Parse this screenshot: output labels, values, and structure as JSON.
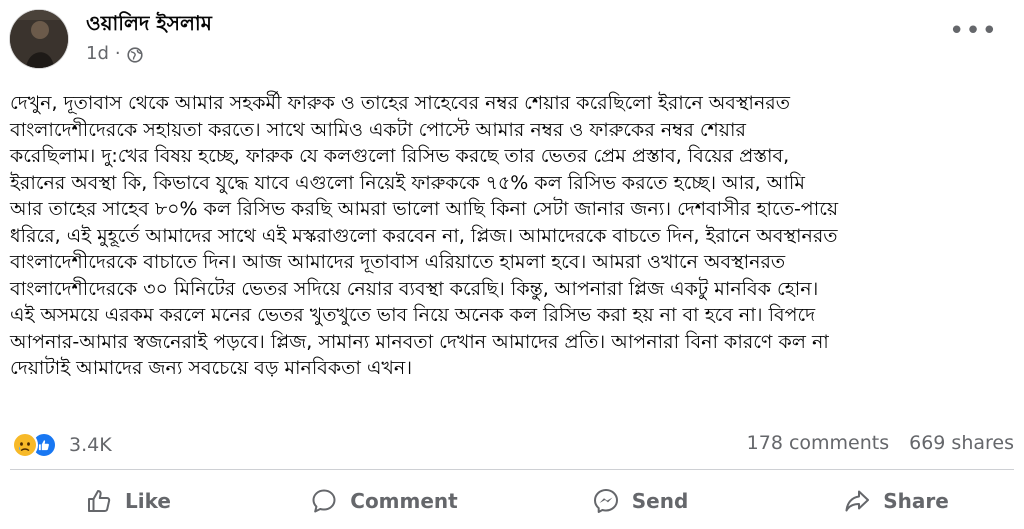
{
  "post": {
    "author": "ওয়ালিদ ইসলাম",
    "time": "1d",
    "separator": "·",
    "privacy_icon": "globe-icon",
    "more_label": "•••",
    "text": "দেখুন, দূতাবাস থেকে আমার সহকর্মী ফারুক ও তাহের সাহেবের নম্বর শেয়ার করেছিলো ইরানে অবস্থানরত\nবাংলাদেশীদেরকে সহায়তা করতে। সাথে আমিও একটা পোস্টে আমার নম্বর ও ফারুকের নম্বর শেয়ার\nকরেছিলাম। দু:খের বিষয় হচ্ছে, ফারুক যে কলগুলো রিসিভ করছে তার ভেতর প্রেম প্রস্তাব, বিয়ের প্রস্তাব,\nইরানের অবস্থা কি, কিভাবে যুদ্ধে যাবে এগুলো নিয়েই ফারুককে ৭৫% কল রিসিভ করতে হচ্ছে। আর, আমি\nআর তাহের সাহেব ৮০% কল রিসিভ করছি আমরা ভালো আছি কিনা সেটা জানার জন্য। দেশবাসীর হাতে-পায়ে\nধরিরে, এই মুহূর্তে আমাদের সাথে এই মস্করাগুলো করবেন না, প্লিজ। আমাদেরকে বাচতে দিন, ইরানে অবস্থানরত\nবাংলাদেশীদেরকে বাচাতে দিন। আজ আমাদের দূতাবাস এরিয়াতে হামলা হবে। আমরা ওখানে অবস্থানরত\nবাংলাদেশীদেরকে ৩০ মিনিটের ভেতর সদিয়ে নেয়ার ব্যবস্থা করেছি। কিন্তু, আপনারা প্লিজ একটু মানবিক হোন।\nএই অসময়ে এরকম করলে মনের ভেতর খুতখুতে ভাব নিয়ে অনেক কল রিসিভ করা হয় না বা হবে না। বিপদে\nআপনার-আমার স্বজনেরাই পড়বে। প্লিজ, সামান্য মানবতা দেখান আমাদের প্রতি। আপনারা বিনা কারণে কল না\nদেয়াটাই আমাদের জন্য সবচেয়ে বড় মানবিকতা এখন।"
  },
  "stats": {
    "reaction_icons": [
      "sad-reaction-icon",
      "like-reaction-icon"
    ],
    "reaction_count": "3.4K",
    "comments": "178 comments",
    "shares": "669 shares"
  },
  "actions": {
    "like": "Like",
    "comment": "Comment",
    "send": "Send",
    "share": "Share"
  },
  "colors": {
    "text": "#050505",
    "secondary": "#65676b",
    "like_blue": "#1877f2",
    "sad_yellow": "#f7b928",
    "divider": "#ced0d4"
  }
}
